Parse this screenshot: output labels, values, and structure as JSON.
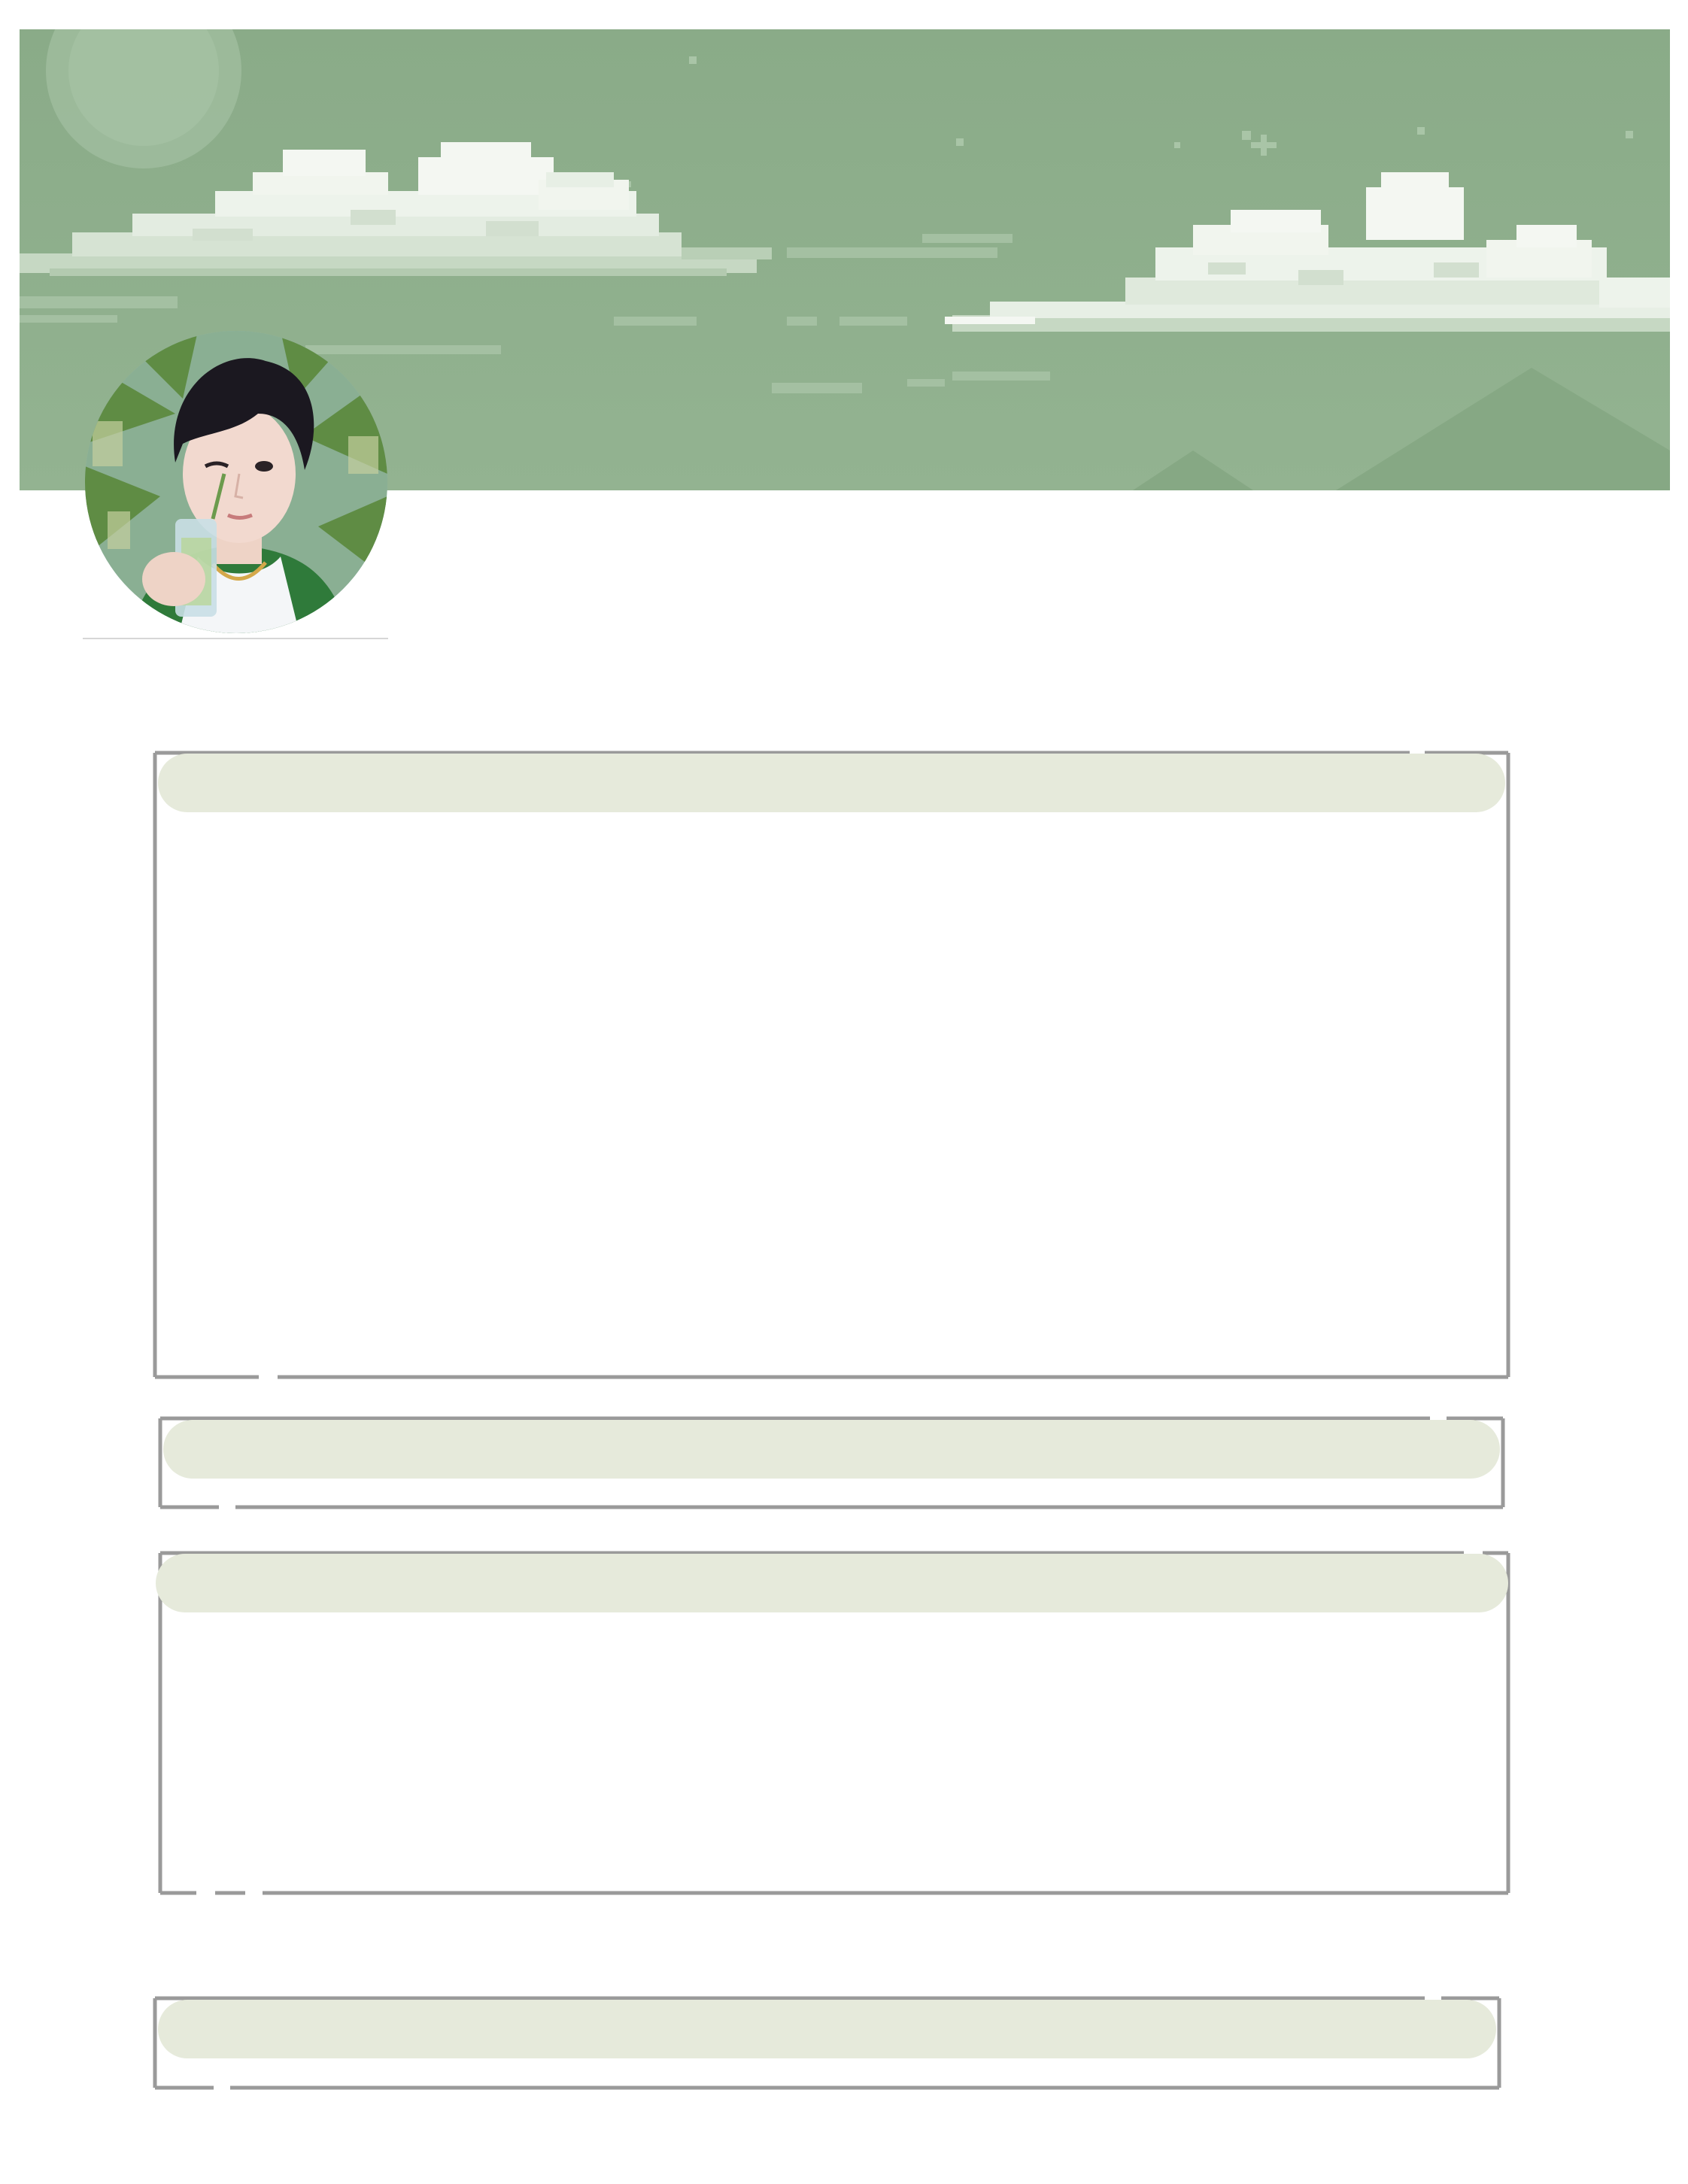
{
  "profile": {
    "banner": {
      "theme": "pixel-art sky with clouds",
      "colors": {
        "sky": "#8fb08d",
        "sky_light": "#a7c2a5",
        "cloud": "#f1f5ee",
        "cloud_shade": "#d2dfcf",
        "moon": "#a3bfa1"
      }
    },
    "avatar": {
      "subject": "profile photo",
      "colors": {
        "hair": "#1b1820",
        "skin": "#f2d9cf",
        "foliage": "#5f8c44",
        "jacket": "#2f7a3a"
      }
    }
  },
  "sections": [
    {
      "id": "section-1",
      "header_label": "",
      "body_text": ""
    },
    {
      "id": "section-2",
      "header_label": "",
      "body_text": ""
    },
    {
      "id": "section-3",
      "header_label": "",
      "body_text": ""
    },
    {
      "id": "section-4",
      "header_label": "",
      "body_text": ""
    }
  ],
  "style": {
    "frame_color": "#9a9a9a",
    "header_pill_color": "#e6eadb",
    "page_background": "#ffffff"
  }
}
